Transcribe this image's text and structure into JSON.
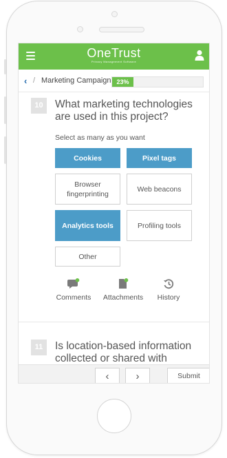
{
  "app": {
    "brand": "OneTrust",
    "brand_sub": "Privacy Management Software"
  },
  "breadcrumb": {
    "current": "Marketing Campaign",
    "progress_label": "23%",
    "progress_value": 0.23
  },
  "question10": {
    "number": "10",
    "text": "What marketing technologies are used in this project?",
    "hint": "Select as many as you want",
    "options": [
      {
        "label": "Cookies",
        "selected": true
      },
      {
        "label": "Pixel tags",
        "selected": true
      },
      {
        "label": "Browser fingerprinting",
        "selected": false
      },
      {
        "label": "Web beacons",
        "selected": false
      },
      {
        "label": "Analytics tools",
        "selected": true
      },
      {
        "label": "Profiling tools",
        "selected": false
      },
      {
        "label": "Other",
        "selected": false
      }
    ],
    "actions": [
      {
        "label": "Comments",
        "icon": "comment-icon"
      },
      {
        "label": "Attachments",
        "icon": "attachment-icon"
      },
      {
        "label": "History",
        "icon": "history-icon"
      }
    ]
  },
  "question11": {
    "number": "11",
    "text": "Is location-based information collected or shared with"
  },
  "footer": {
    "prev_label": "‹",
    "next_label": "›",
    "submit_label": "Submit"
  },
  "colors": {
    "brand_green": "#6cc04a",
    "selected_blue": "#4c9cc8",
    "back_blue": "#2a6fb0"
  }
}
